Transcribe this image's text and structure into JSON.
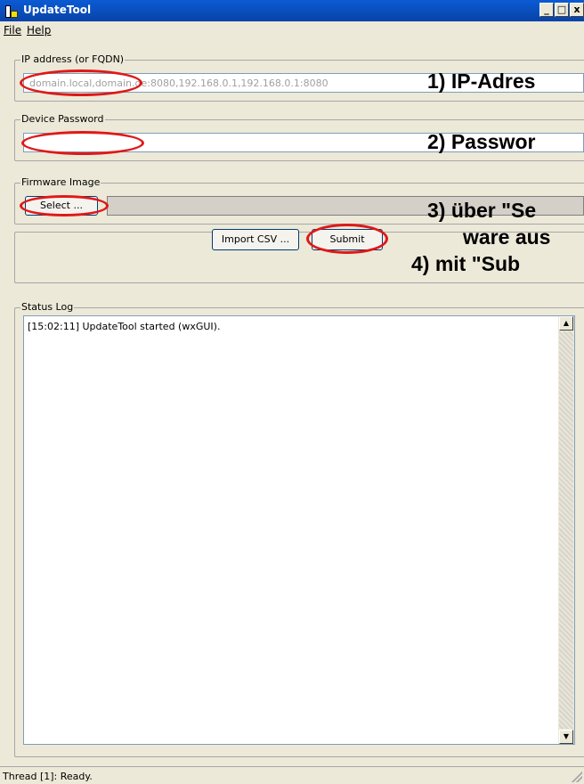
{
  "window": {
    "title": "UpdateTool",
    "controls": {
      "minimize": "_",
      "maximize": "□",
      "close": "x"
    }
  },
  "menu": [
    {
      "label": "File"
    },
    {
      "label": "Help"
    }
  ],
  "ip_group": {
    "label": "IP address (or FQDN)",
    "placeholder": "domain.local,domain.de:8080,192.168.0.1,192.168.0.1:8080"
  },
  "password_group": {
    "label": "Device Password",
    "value": ""
  },
  "firmware_group": {
    "label": "Firmware Image",
    "select_label": "Select ...",
    "path_value": ""
  },
  "actions": {
    "import_label": "Import CSV ...",
    "submit_label": "Submit"
  },
  "status_log": {
    "label": "Status Log",
    "lines": [
      "[15:02:11] UpdateTool started (wxGUI)."
    ]
  },
  "statusbar": {
    "text": "Thread [1]: Ready."
  },
  "annotations": {
    "step1": "1) IP-Adres",
    "step2": "2) Passwor",
    "step3a": "3) über \"Se",
    "step3b": "ware aus",
    "step4": "4) mit \"Sub"
  },
  "colors": {
    "highlight": "#e01818",
    "titlebar": "#0b5bd4",
    "window_bg": "#ece9d8"
  }
}
